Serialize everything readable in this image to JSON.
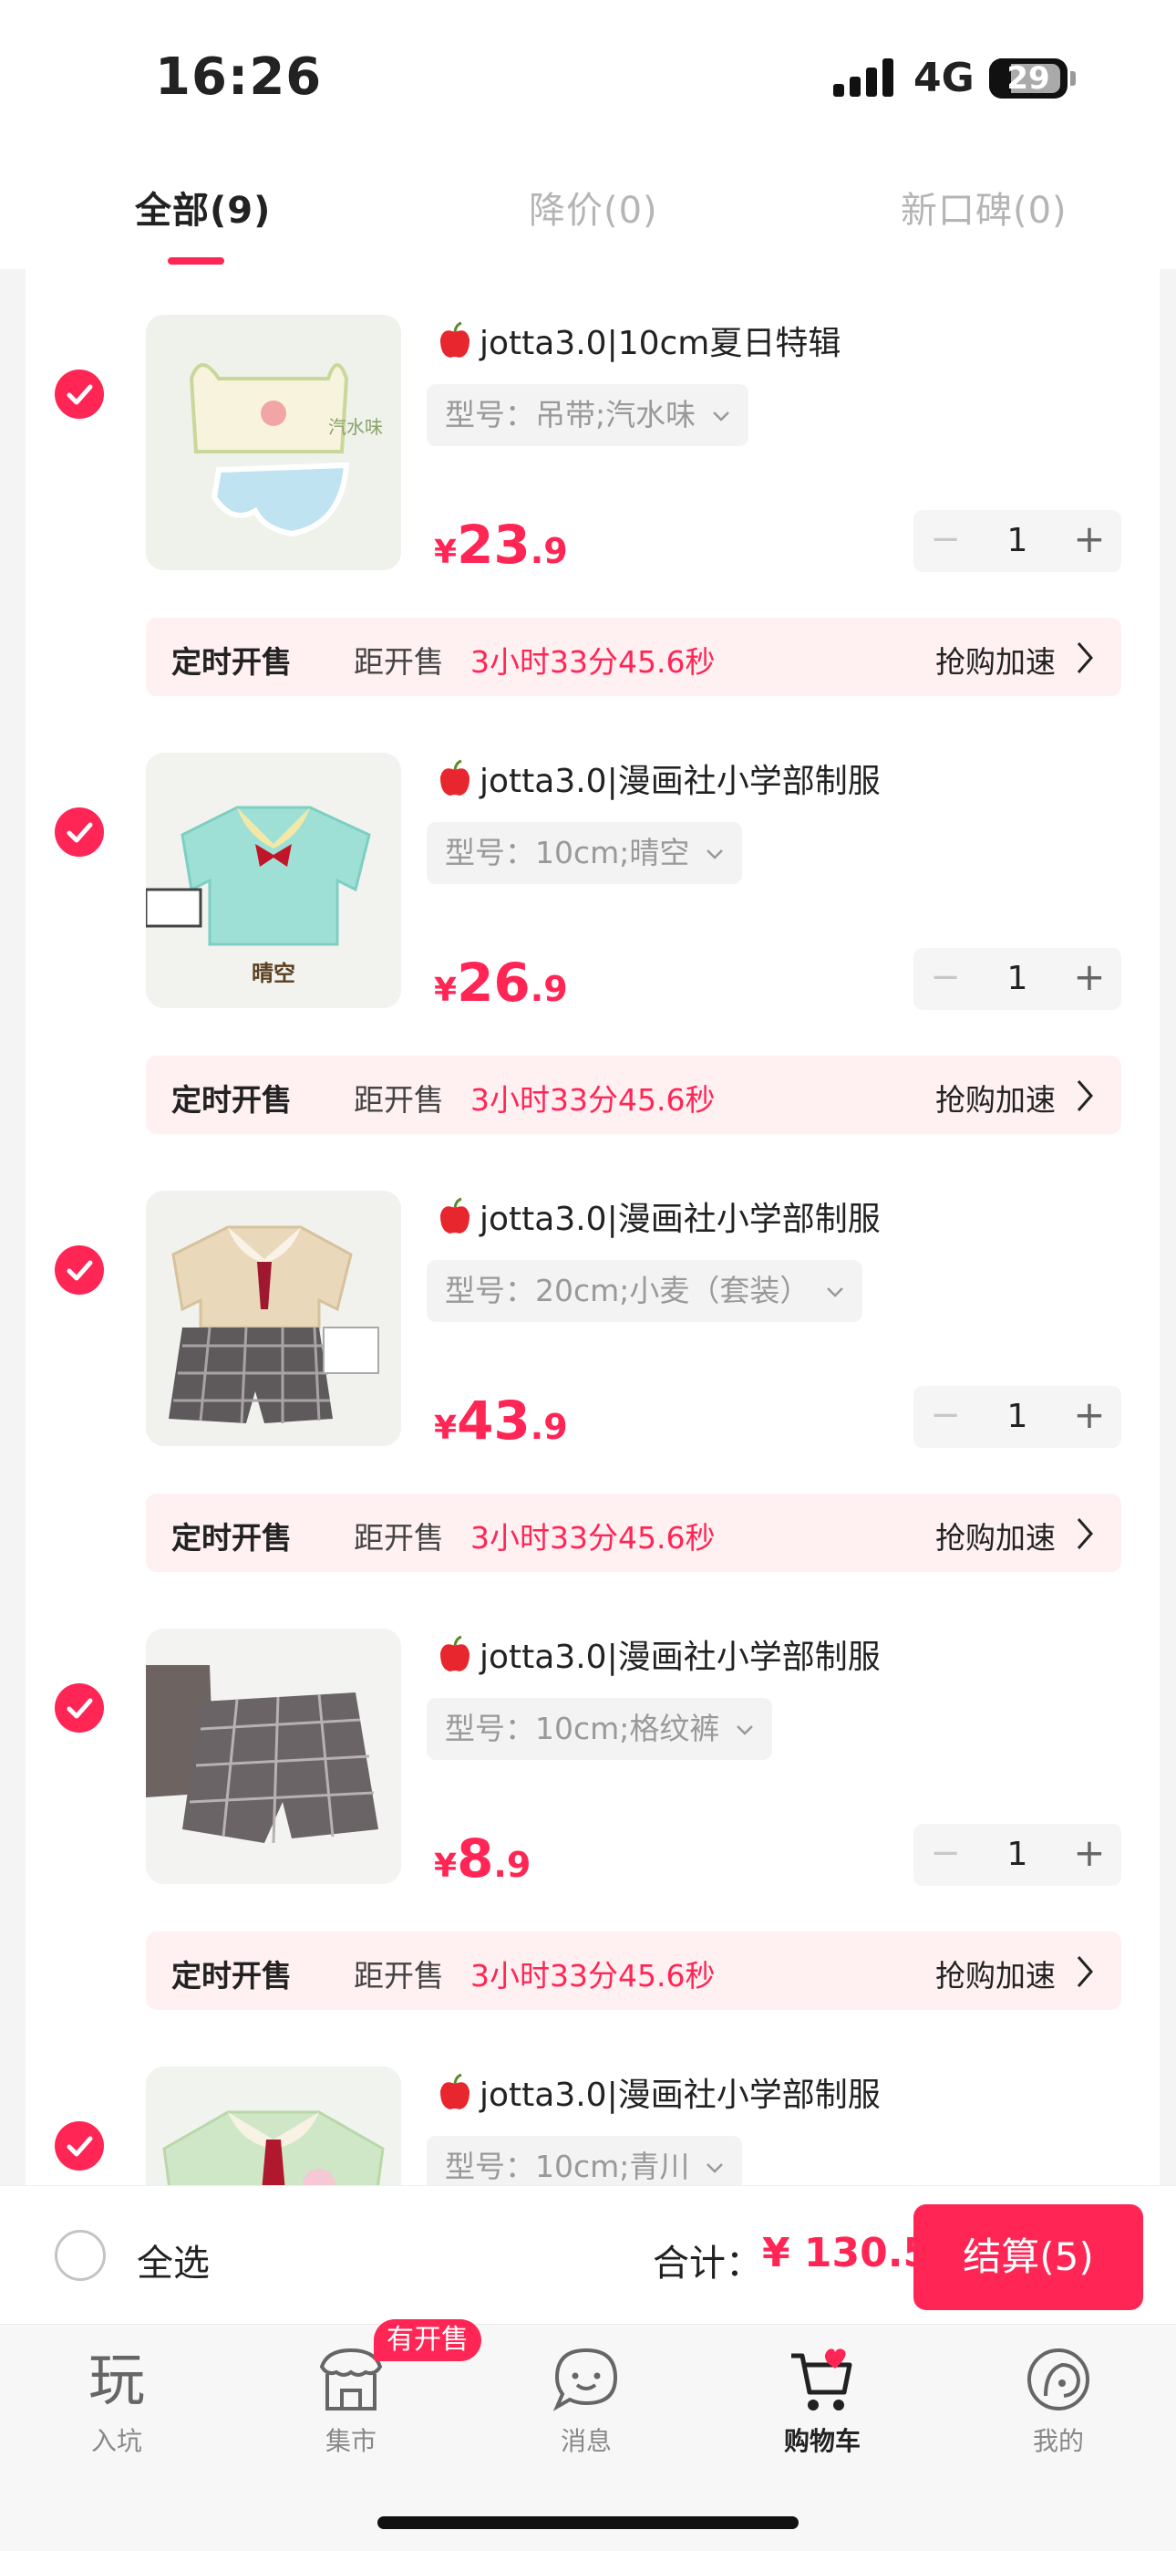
{
  "status_bar": {
    "time": "16:26",
    "network": "4G",
    "battery": "29"
  },
  "tabs": [
    {
      "label": "全部(9)",
      "active": true
    },
    {
      "label": "降价(0)",
      "active": false
    },
    {
      "label": "新口碑(0)",
      "active": false
    }
  ],
  "items": [
    {
      "title": "jotta3.0|10cm夏日特辑",
      "spec": "型号：吊带;汽水味",
      "price_int": "23",
      "price_dec": ".9",
      "qty": "1",
      "checked": true
    },
    {
      "title": "jotta3.0|漫画社小学部制服",
      "spec": "型号：10cm;晴空",
      "price_int": "26",
      "price_dec": ".9",
      "qty": "1",
      "checked": true
    },
    {
      "title": "jotta3.0|漫画社小学部制服",
      "spec": "型号：20cm;小麦（套装）",
      "price_int": "43",
      "price_dec": ".9",
      "qty": "1",
      "checked": true
    },
    {
      "title": "jotta3.0|漫画社小学部制服",
      "spec": "型号：10cm;格纹裤",
      "price_int": "8",
      "price_dec": ".9",
      "qty": "1",
      "checked": true
    },
    {
      "title": "jotta3.0|漫画社小学部制服",
      "spec": "型号：10cm;青川",
      "price_int": "",
      "price_dec": "",
      "qty": "",
      "checked": true
    }
  ],
  "sale": {
    "label": "定时开售",
    "prefix": "距开售",
    "countdown": "3小时33分45.6秒",
    "action": "抢购加速"
  },
  "currency": "¥",
  "checkout": {
    "select_all": "全选",
    "total_label": "合计：",
    "total_value": "¥ 130.5",
    "pay_label": "结算(5)"
  },
  "nav": {
    "items": [
      {
        "label": "入坑",
        "icon": "play-icon"
      },
      {
        "label": "集市",
        "icon": "market-icon"
      },
      {
        "label": "消息",
        "icon": "message-icon"
      },
      {
        "label": "购物车",
        "icon": "cart-icon"
      },
      {
        "label": "我的",
        "icon": "profile-icon"
      }
    ],
    "badge": "有开售",
    "play_glyph": "玩"
  },
  "colors": {
    "accent": "#ff2655",
    "sale_bg": "#fff0f2"
  }
}
